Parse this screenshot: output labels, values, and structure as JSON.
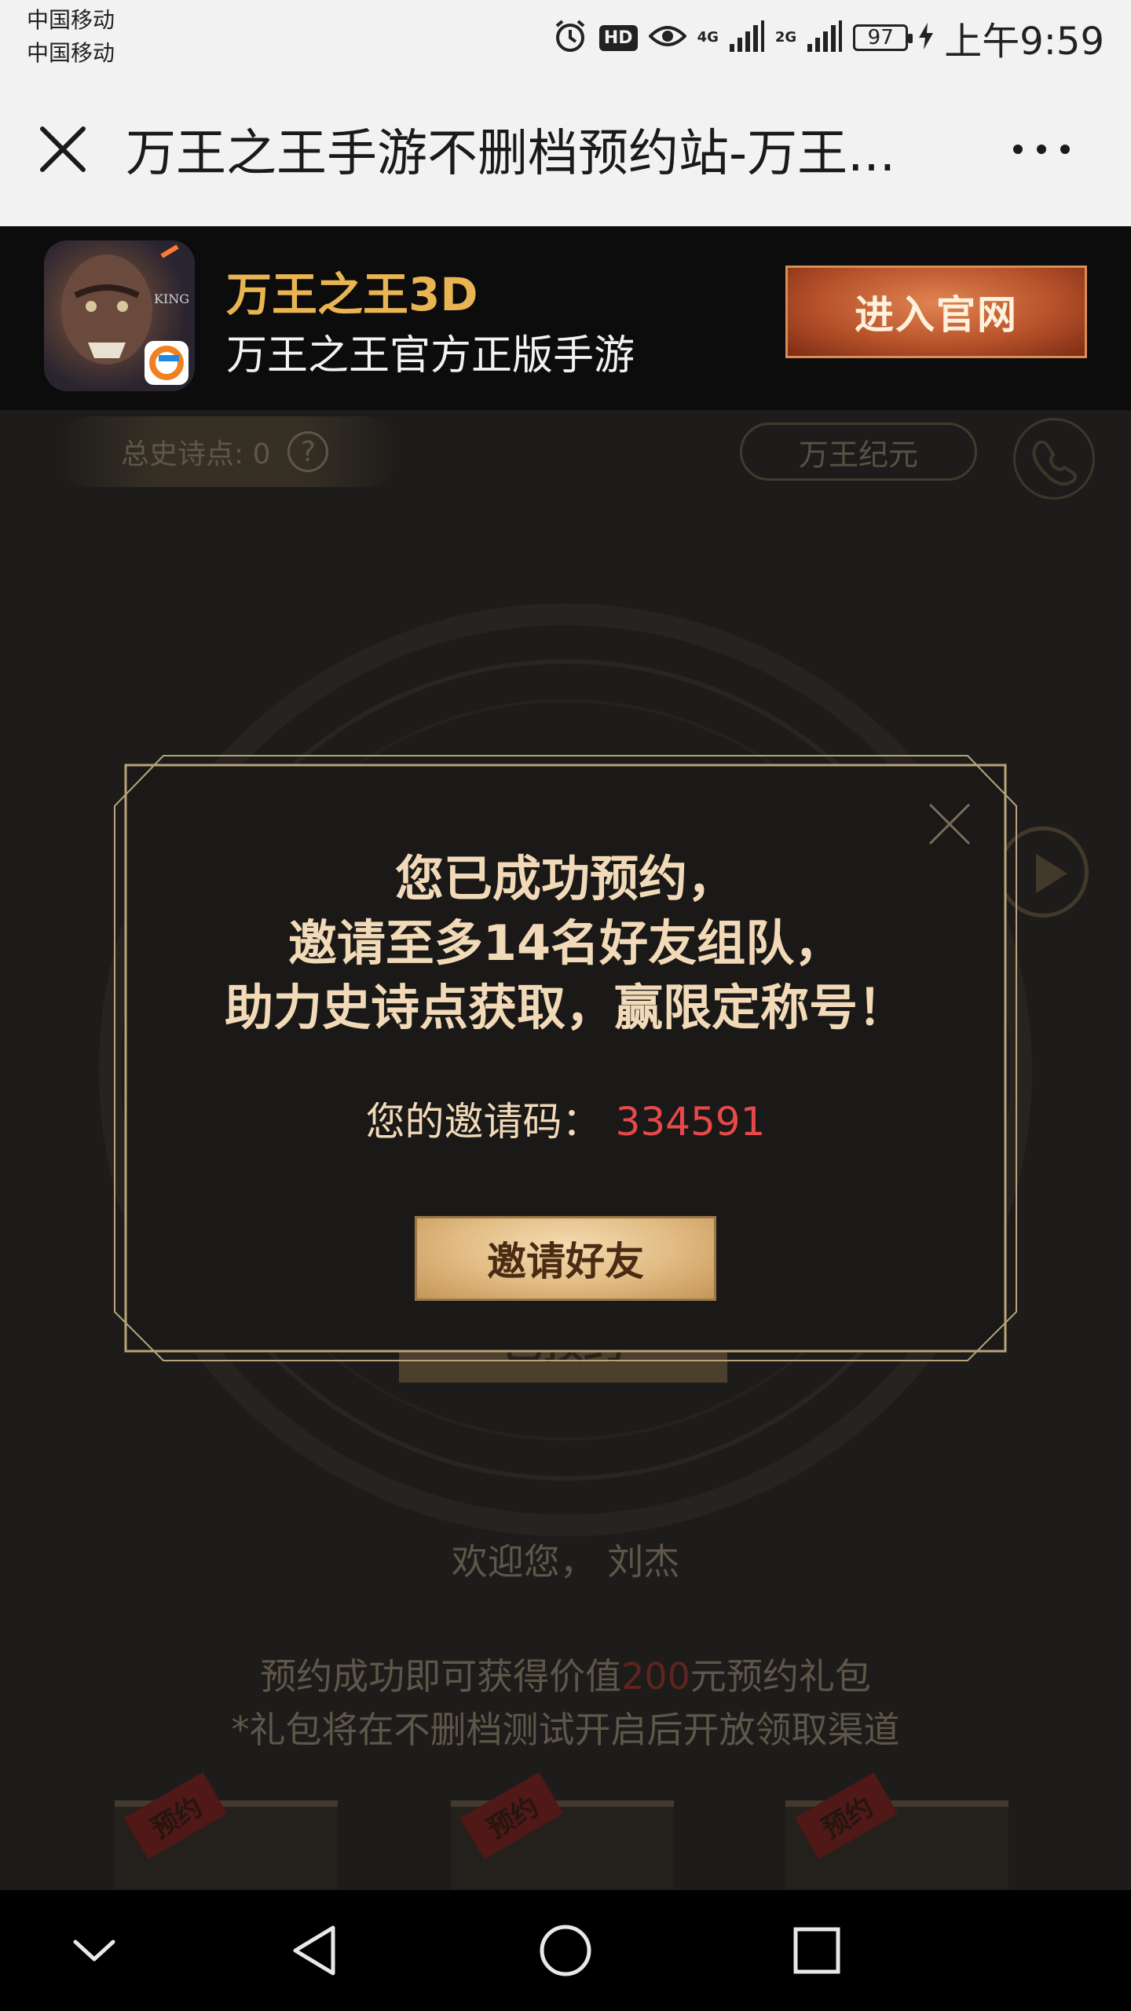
{
  "status_bar": {
    "carrier_1": "中国移动",
    "carrier_2": "中国移动",
    "hd_badge": "HD",
    "network_1": "4G",
    "network_2": "2G",
    "battery": "97",
    "time": "上午9:59",
    "icons": [
      "alarm-icon",
      "eye-icon",
      "signal-icon",
      "charging-icon"
    ]
  },
  "browser": {
    "title": "万王之王手游不删档预约站-万王...",
    "icons": [
      "close-icon",
      "more-icon"
    ]
  },
  "app_banner": {
    "name": "万王之王3D",
    "subtitle": "万王之王官方正版手游",
    "enter_button": "进入官网",
    "icon_text": "KING",
    "colors": {
      "name": "#e9b552",
      "button": "#b8532b"
    }
  },
  "game_page": {
    "epic_points": "总史诗点: 0",
    "help_symbol": "?",
    "era_button": "万王纪元",
    "reserved_button": "已预约",
    "welcome": "欢迎您， 刘杰",
    "gift_line_prefix": "预约成功即可获得价值",
    "gift_amount": "200",
    "gift_line_suffix": "元预约礼包",
    "gift_note": "*礼包将在不删档测试开启后开放领取渠道",
    "card_ribbon": "预约"
  },
  "modal": {
    "lines": [
      "您已成功预约，",
      "邀请至多14名好友组队，",
      "助力史诗点获取，赢限定称号！"
    ],
    "invite_code_label": "您的邀请码：",
    "invite_code": "334591",
    "invite_button": "邀请好友",
    "colors": {
      "text": "#f2dab8",
      "code": "#e7494a",
      "frame": "#b9a37a"
    }
  },
  "nav_bar": {
    "icons": [
      "chevron-down-icon",
      "back-icon",
      "home-icon",
      "recents-icon"
    ]
  }
}
